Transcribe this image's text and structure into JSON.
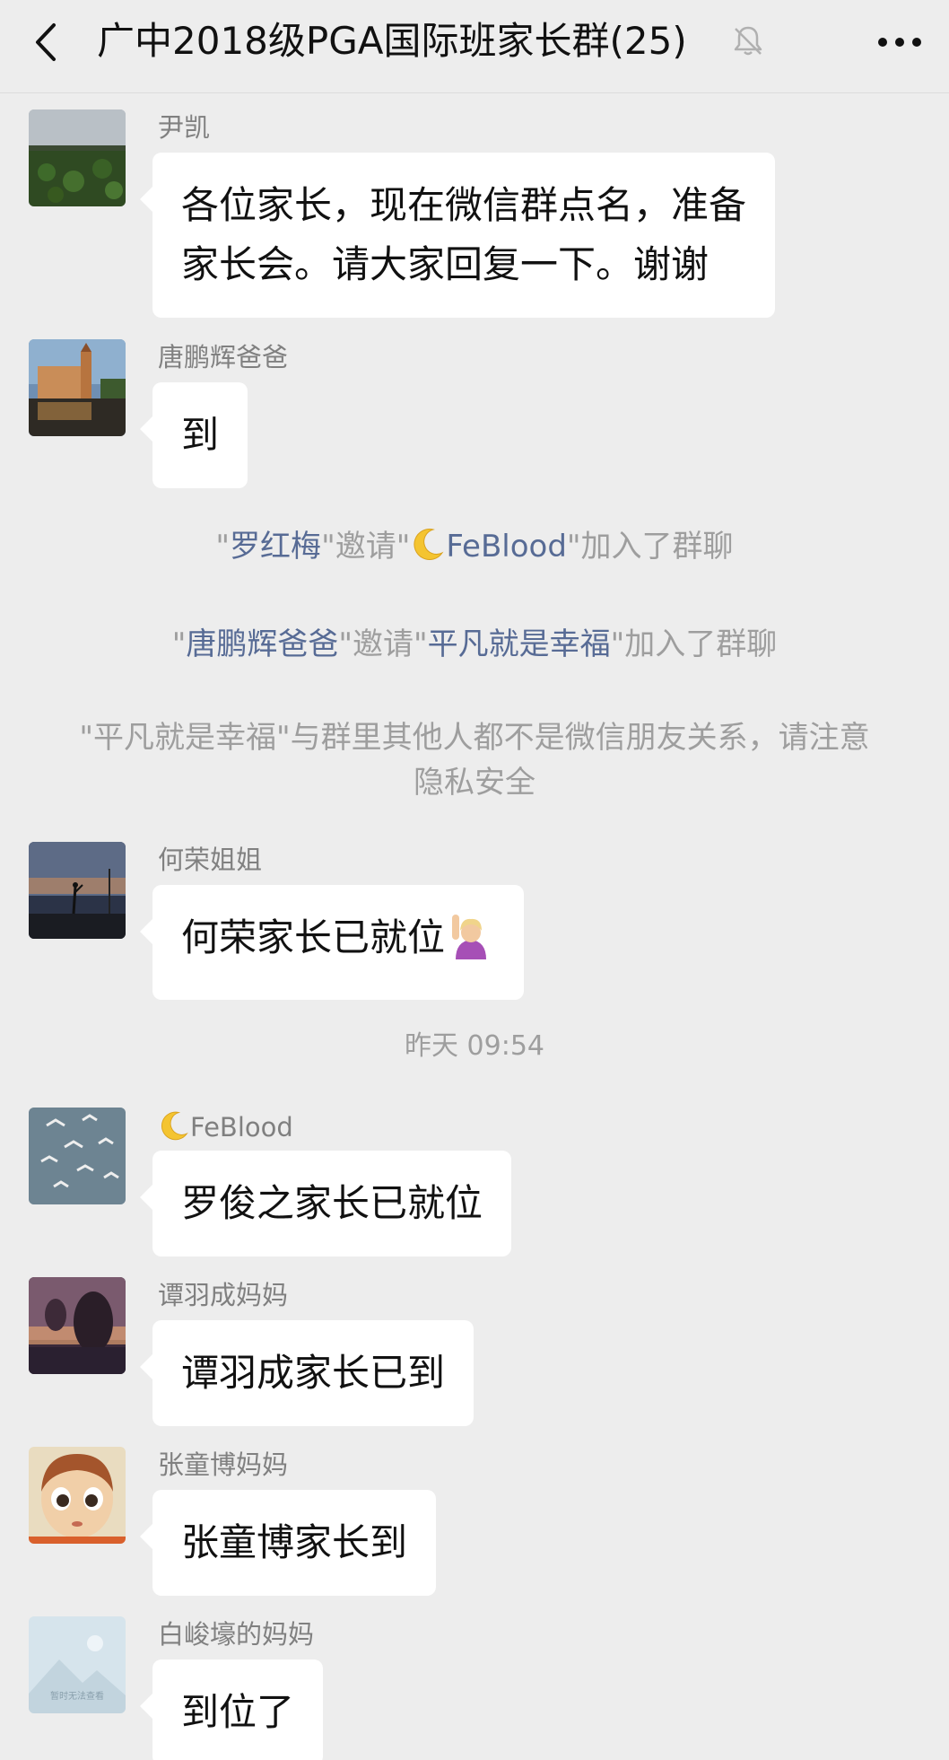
{
  "header": {
    "title": "广中2018级PGA国际班家长群(25)"
  },
  "messages": [
    {
      "sender": "尹凯",
      "lines": [
        "各位家长，现在微信群点名，准备",
        "家长会。请大家回复一下。谢谢"
      ]
    },
    {
      "sender": "唐鹏辉爸爸",
      "lines": [
        "到"
      ]
    },
    {
      "sender": "何荣姐姐",
      "lines": [
        "何荣家长已就位"
      ]
    },
    {
      "sender": "FeBlood",
      "lines": [
        "罗俊之家长已就位"
      ]
    },
    {
      "sender": "谭羽成妈妈",
      "lines": [
        "谭羽成家长已到"
      ]
    },
    {
      "sender": "张童博妈妈",
      "lines": [
        "张童博家长到"
      ]
    },
    {
      "sender": "白峻壕的妈妈",
      "lines": [
        "到位了"
      ]
    }
  ],
  "notices": [
    {
      "q1": "\"",
      "inviter": "罗红梅",
      "mid": "\"邀请\"",
      "invitee": "FeBlood",
      "end": "\"加入了群聊"
    },
    {
      "q1": "\"",
      "inviter": "唐鹏辉爸爸",
      "mid": "\"邀请\"",
      "invitee": "平凡就是幸福",
      "end": "\"加入了群聊"
    },
    {
      "text": "\"平凡就是幸福\"与群里其他人都不是微信朋友关系，请注意隐私安全"
    }
  ],
  "timestamp": "昨天 09:54",
  "placeholder_avatar_text": "暂时无法查看",
  "colors": {
    "background": "#ededed",
    "bubble": "#ffffff",
    "link_name": "#576b95",
    "notice_text": "#9e9e9e"
  },
  "icons": [
    "back-arrow-icon",
    "mute-bell-icon",
    "more-dots-icon",
    "moon-emoji-icon",
    "raising-hand-emoji-icon"
  ]
}
